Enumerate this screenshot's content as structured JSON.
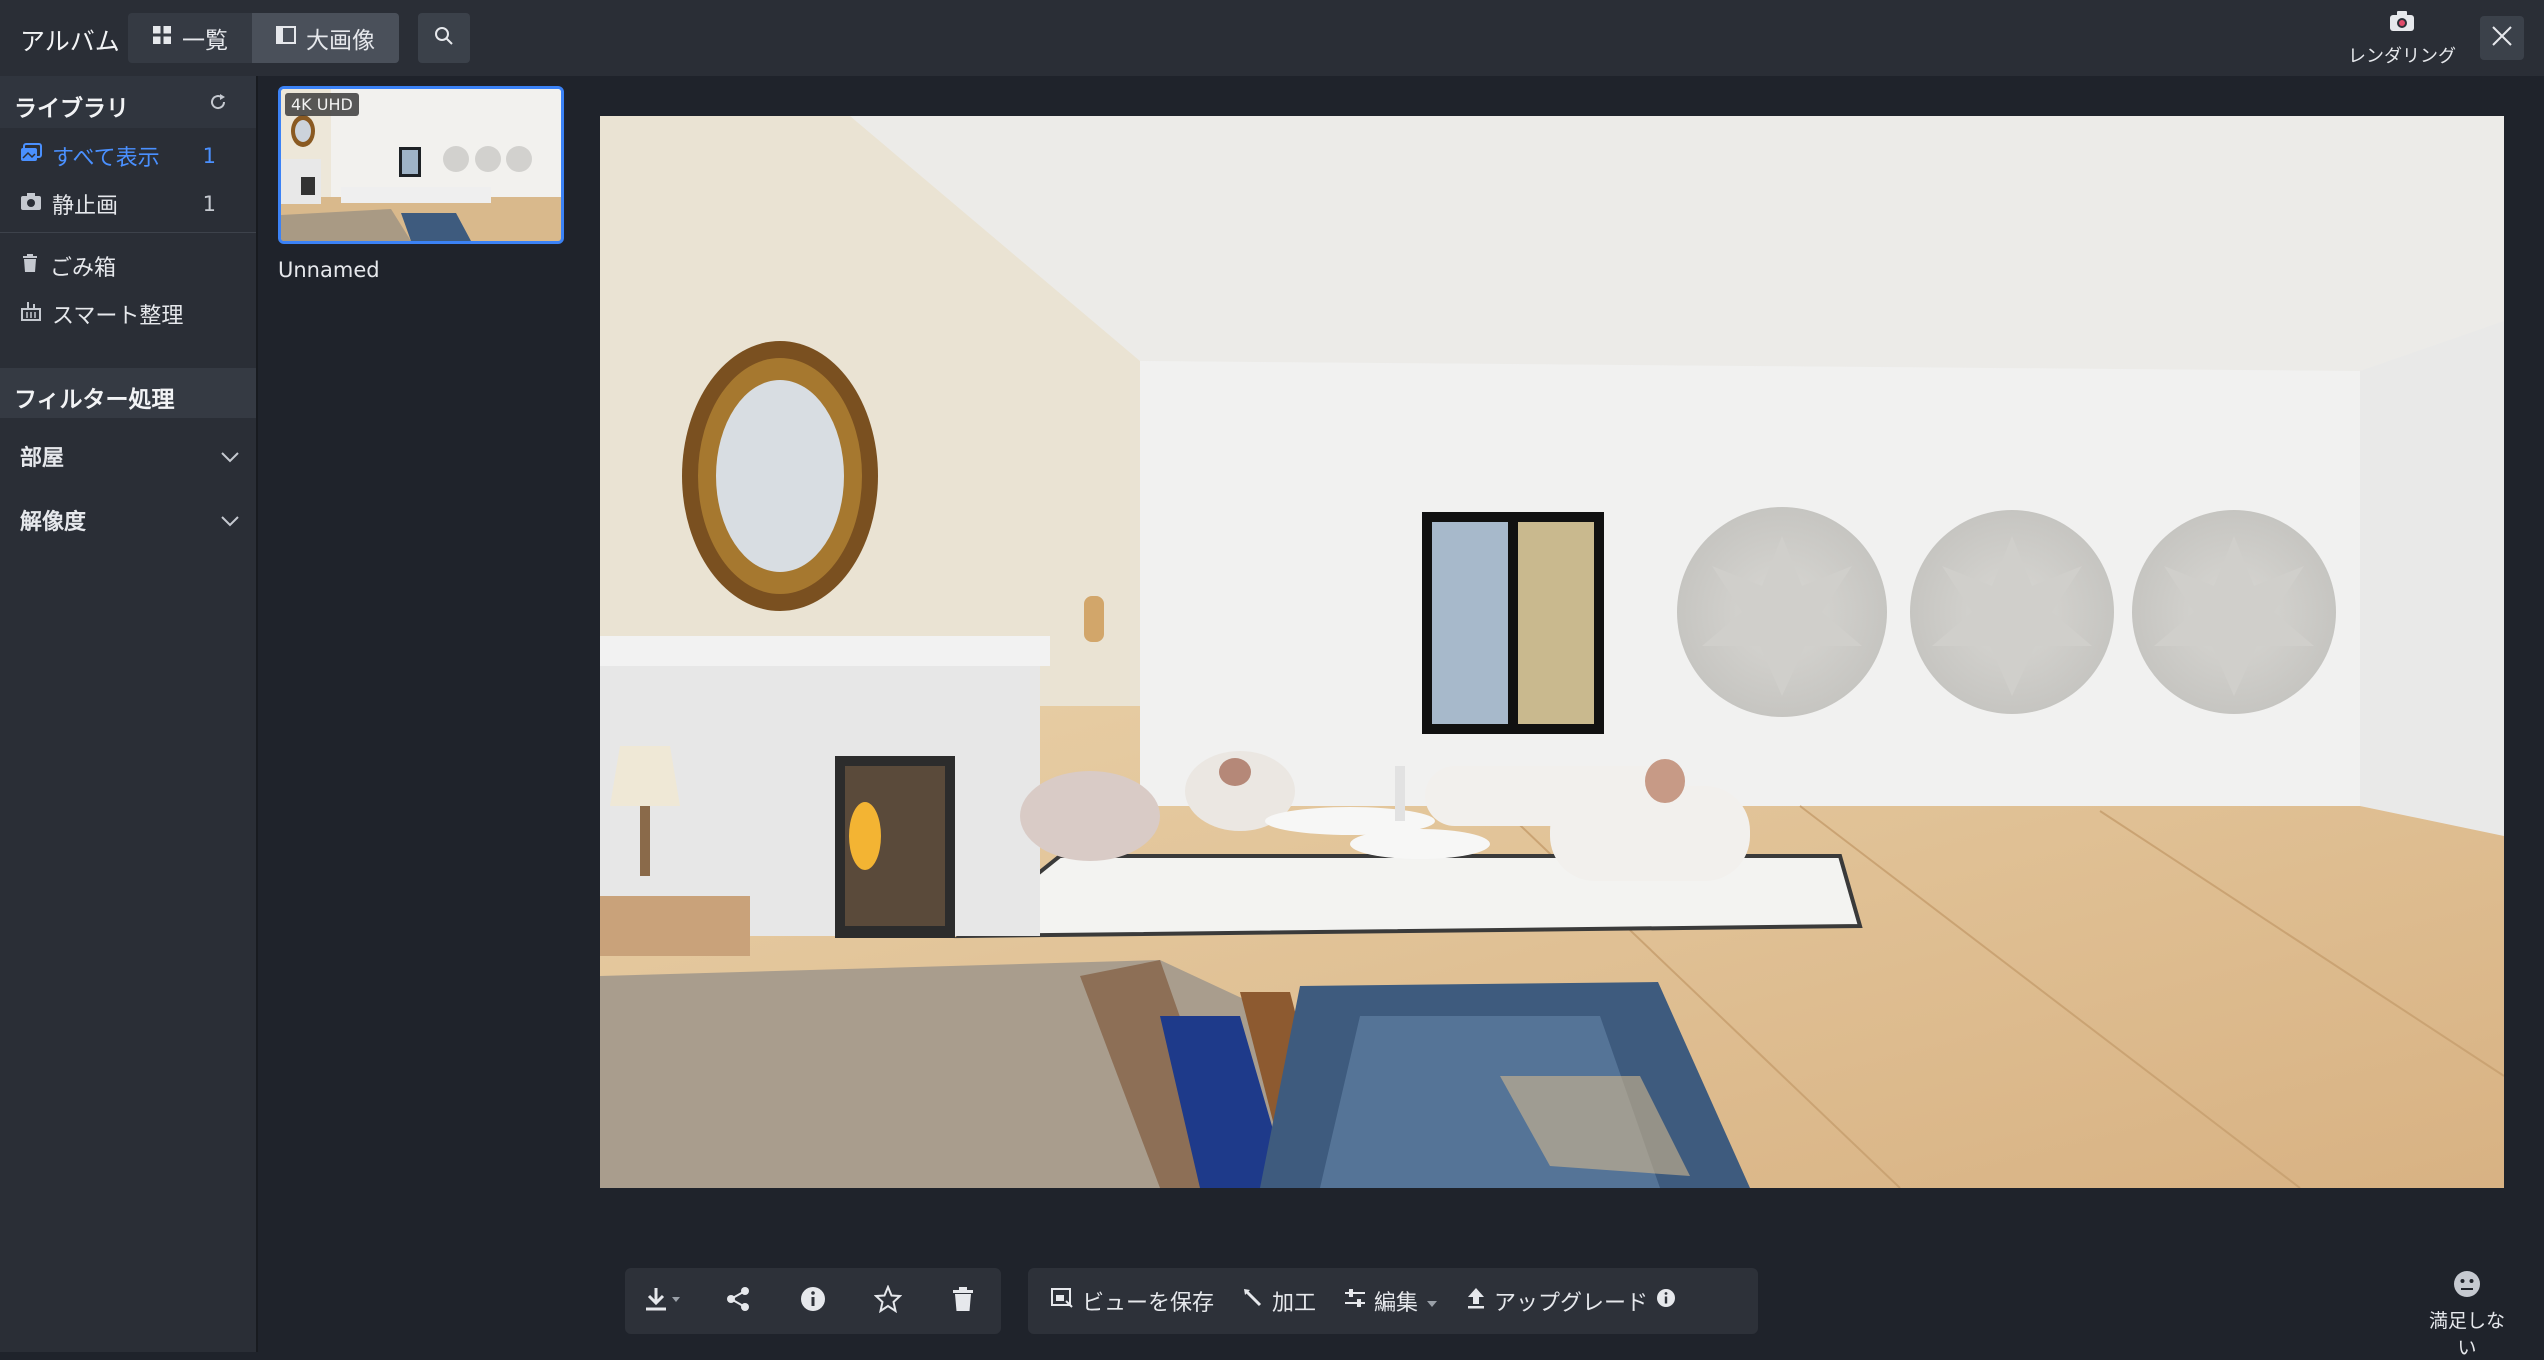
{
  "topbar": {
    "app_title": "アルバム",
    "view_list_label": "一覧",
    "view_large_label": "大画像",
    "render_label": "レンダリング"
  },
  "sidebar": {
    "library_title": "ライブラリ",
    "items": [
      {
        "label": "すべて表示",
        "count": "1"
      },
      {
        "label": "静止画",
        "count": "1"
      },
      {
        "label": "ごみ箱"
      },
      {
        "label": "スマート整理"
      }
    ],
    "filter_title": "フィルター処理",
    "filters": [
      {
        "label": "部屋"
      },
      {
        "label": "解像度"
      }
    ]
  },
  "gallery": {
    "items": [
      {
        "badge": "4K UHD",
        "name": "Unnamed"
      }
    ]
  },
  "toolbar": {
    "save_view_label": "ビューを保存",
    "process_label": "加工",
    "edit_label": "編集",
    "upgrade_label": "アップグレード"
  },
  "feedback": {
    "label": "満足しない"
  },
  "colors": {
    "accent": "#3b82f6",
    "active_text": "#4a90ff",
    "background": "#1f232b",
    "panel": "#2a2e36"
  }
}
